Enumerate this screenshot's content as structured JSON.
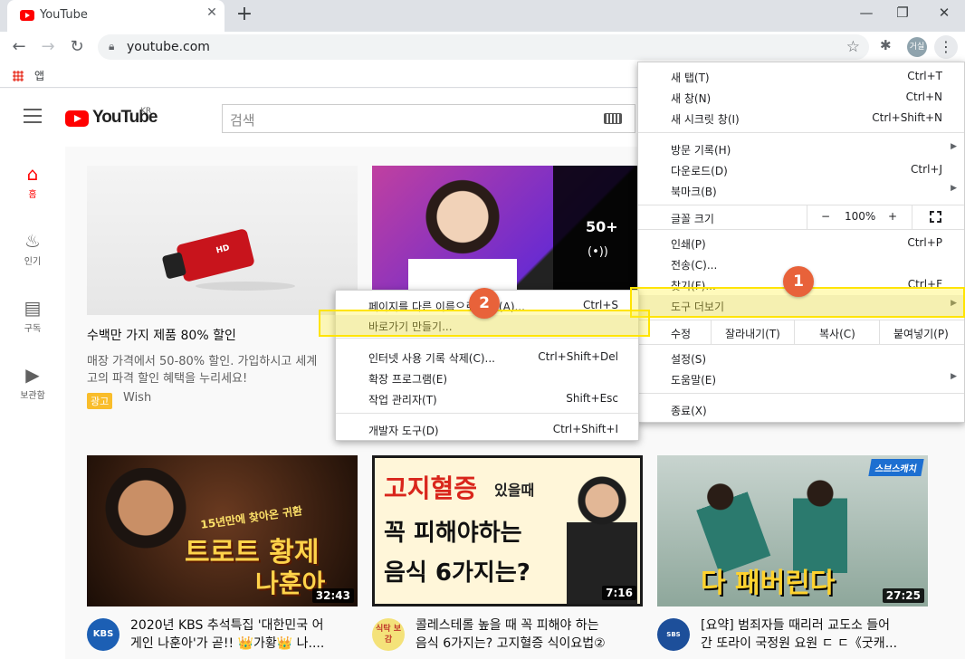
{
  "browser": {
    "tab_title": "YouTube",
    "tab_close": "✕",
    "new_tab": "+",
    "url": "youtube.com",
    "avatar_label": "거실",
    "bookmarks_apps": "앱",
    "win_min": "—",
    "win_max": "❐",
    "win_close": "✕"
  },
  "youtube": {
    "logo_text": "YouTube",
    "country": "KR",
    "search_placeholder": "검색",
    "sidebar": [
      {
        "label": "홈",
        "icon": "home-icon"
      },
      {
        "label": "인기",
        "icon": "fire-icon"
      },
      {
        "label": "구독",
        "icon": "subscriptions-icon"
      },
      {
        "label": "보관함",
        "icon": "library-icon"
      }
    ],
    "ad": {
      "title": "수백만 가지 제품 80% 할인",
      "desc1": "매장 가격에서 50-80% 할인. 가입하시고 세계",
      "desc2": "고의 파격 할인 혜택을 누리세요!",
      "badge": "광고",
      "channel": "Wish",
      "camera_text": "HD"
    },
    "live_card": {
      "count": "50+",
      "live_icon": "(•))"
    },
    "videos": [
      {
        "thumb_text1": "15년만에 찾아온 귀환",
        "thumb_text2": "트로트 황제",
        "thumb_text3": "나훈아",
        "duration": "32:43",
        "title1": "2020년 KBS 추석특집 '대한민국 어",
        "title2": "게인 나훈아'가 곧!! 👑가황👑 나....",
        "channel_badge": "KBS"
      },
      {
        "thumb_text1": "고지혈증",
        "thumb_text1b": "있을때",
        "thumb_text2": "꼭 피해야하는",
        "thumb_text3": "음식 6가지는?",
        "duration": "7:16",
        "title1": "콜레스테롤 높을 때 꼭 피해야 하는",
        "title2": "음식 6가지는? 고지혈증 식이요법②",
        "channel_badge": "식탁 보감"
      },
      {
        "thumb_text1": "스브스캐치",
        "thumb_text2": "다 패버린다",
        "duration": "27:25",
        "title1": "[요약] 범죄자들 때리러 교도소 들어",
        "title2": "간 또라이 국정원 요원 ㄷ ㄷ《굿캐...",
        "channel_badge": "SBS Catch"
      }
    ]
  },
  "menu": {
    "items": [
      {
        "label": "새 탭(T)",
        "shortcut": "Ctrl+T"
      },
      {
        "label": "새 창(N)",
        "shortcut": "Ctrl+N"
      },
      {
        "label": "새 시크릿 창(I)",
        "shortcut": "Ctrl+Shift+N"
      },
      {
        "label": "방문 기록(H)",
        "shortcut": ""
      },
      {
        "label": "다운로드(D)",
        "shortcut": "Ctrl+J"
      },
      {
        "label": "북마크(B)",
        "shortcut": ""
      },
      {
        "label": "인쇄(P)",
        "shortcut": "Ctrl+P"
      },
      {
        "label": "전송(C)...",
        "shortcut": ""
      },
      {
        "label": "찾기(F)...",
        "shortcut": "Ctrl+F"
      },
      {
        "label": "도구 더보기",
        "shortcut": ""
      },
      {
        "label": "설정(S)",
        "shortcut": ""
      },
      {
        "label": "도움말(E)",
        "shortcut": ""
      },
      {
        "label": "종료(X)",
        "shortcut": ""
      }
    ],
    "zoom": {
      "label": "글꼴 크기",
      "minus": "−",
      "value": "100%",
      "plus": "+"
    },
    "edit": {
      "label": "수정",
      "cut": "잘라내기(T)",
      "copy": "복사(C)",
      "paste": "붙여넣기(P)"
    }
  },
  "submenu": {
    "items": [
      {
        "label": "페이지를 다른 이름으로 저장(A)...",
        "shortcut": "Ctrl+S"
      },
      {
        "label": "바로가기 만들기...",
        "shortcut": ""
      },
      {
        "label": "인터넷 사용 기록 삭제(C)...",
        "shortcut": "Ctrl+Shift+Del"
      },
      {
        "label": "확장 프로그램(E)",
        "shortcut": ""
      },
      {
        "label": "작업 관리자(T)",
        "shortcut": "Shift+Esc"
      },
      {
        "label": "개발자 도구(D)",
        "shortcut": "Ctrl+Shift+I"
      }
    ]
  },
  "annotations": {
    "step1": "1",
    "step2": "2"
  },
  "colors": {
    "yt_red": "#ff0000",
    "highlight": "#ffe400",
    "badge": "#e8623a"
  }
}
